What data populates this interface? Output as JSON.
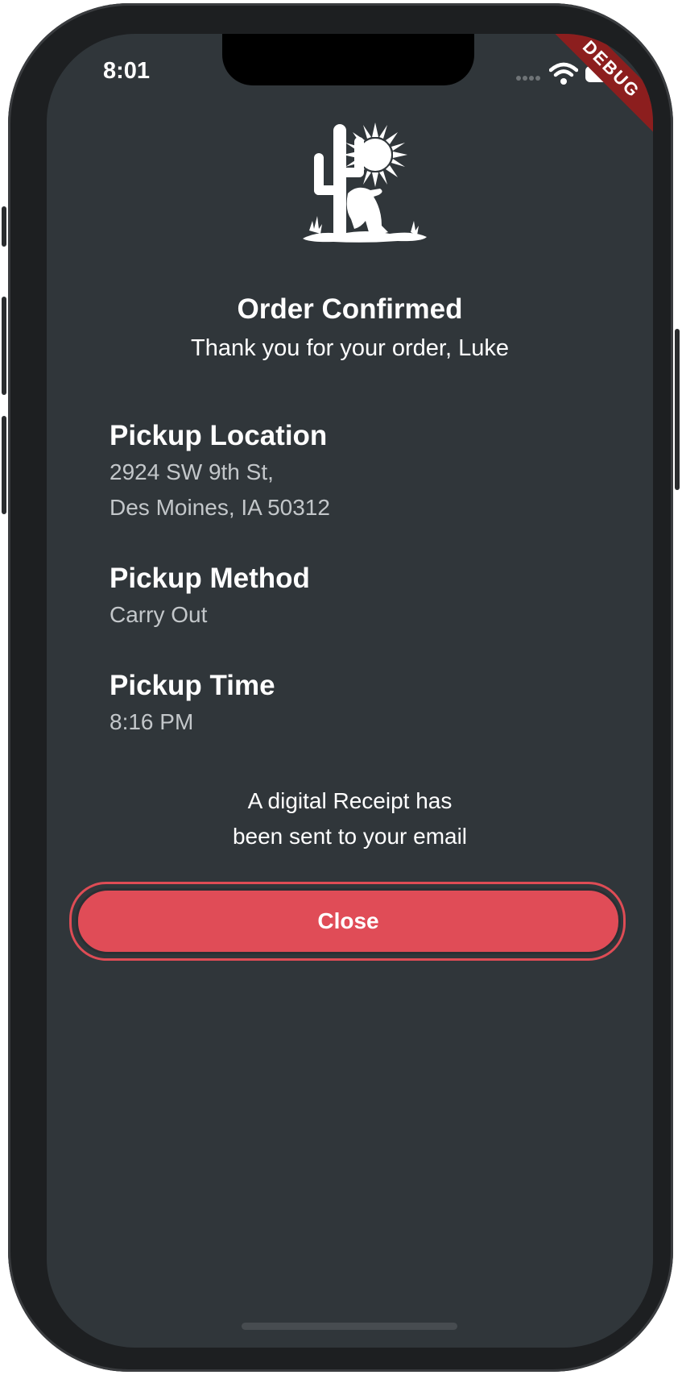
{
  "status_bar": {
    "time": "8:01",
    "debug_label": "DEBUG"
  },
  "header": {
    "logo_icon": "cactus-sun-logo-icon",
    "title": "Order Confirmed",
    "subtitle": "Thank you for your order, Luke"
  },
  "pickup_location": {
    "label": "Pickup Location",
    "line1": "2924 SW 9th St,",
    "line2": "Des Moines, IA 50312"
  },
  "pickup_method": {
    "label": "Pickup Method",
    "value": "Carry Out"
  },
  "pickup_time": {
    "label": "Pickup Time",
    "value": "8:16 PM"
  },
  "receipt_message": {
    "line1": "A digital Receipt has",
    "line2": "been sent to your email"
  },
  "actions": {
    "close_label": "Close"
  },
  "colors": {
    "background": "#30363a",
    "accent": "#e04c57",
    "debug_ribbon": "#8c1e1e"
  }
}
